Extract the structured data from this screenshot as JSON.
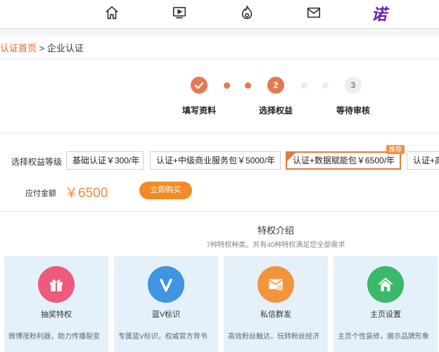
{
  "nav": {
    "icons": [
      "home-icon",
      "video-icon",
      "fire-icon",
      "mail-icon"
    ],
    "logo_text": "诺"
  },
  "breadcrumb": {
    "home": "认证首页",
    "separator": ">",
    "current": "企业认证"
  },
  "steps": {
    "step1": {
      "number": "✓",
      "label": "填写资料"
    },
    "step2": {
      "number": "2",
      "label": "选择权益"
    },
    "step3": {
      "number": "3",
      "label": "等待审核"
    }
  },
  "level": {
    "label": "选择权益等级",
    "packages": [
      "基础认证￥300/年",
      "认证+中级商业服务包￥5000/年",
      "认证+数据赋能包￥6500/年",
      "认证+高"
    ],
    "selected_index": 2,
    "badge": "推荐"
  },
  "payment": {
    "label": "应付金额",
    "amount": "￥6500",
    "buy_button": "立即购买"
  },
  "privileges": {
    "title": "特权介绍",
    "subtitle": "7种特权种类。共有40种特权满足您全部需求",
    "cards": [
      {
        "title": "抽奖特权",
        "desc": "微博涨粉利器，助力传播裂变",
        "icon": "gift-icon",
        "color": "#ee5b7a"
      },
      {
        "title": "蓝V标识",
        "desc": "专属蓝V标识，权威官方背书",
        "icon": "v-badge-icon",
        "color": "#3f95e0"
      },
      {
        "title": "私信群发",
        "desc": "高效粉丝触达，玩转粉丝经济",
        "icon": "message-icon",
        "color": "#f4943a"
      },
      {
        "title": "主页设置",
        "desc": "主页个性装修，展示品牌形象",
        "icon": "home-page-icon",
        "color": "#3cb86a"
      }
    ]
  },
  "colors": {
    "accent": "#e4794f",
    "buy": "#f28a25",
    "card_bg": "#e4f1fb"
  }
}
